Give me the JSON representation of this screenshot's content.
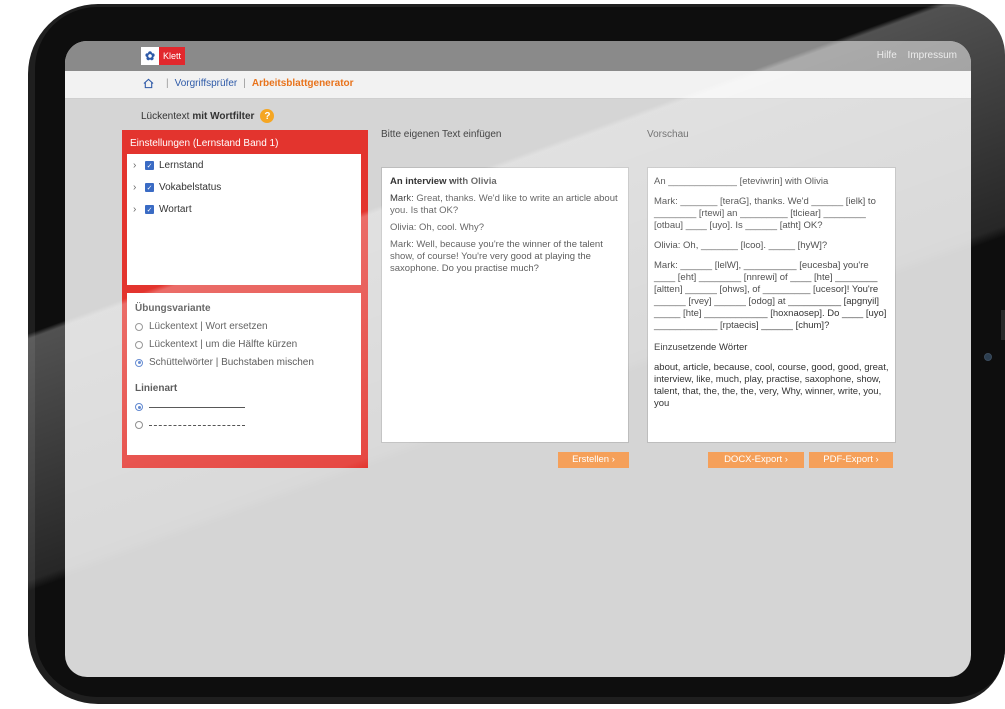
{
  "header": {
    "logo_text": "Klett",
    "links": [
      "Hilfe",
      "Impressum"
    ]
  },
  "breadcrumb": {
    "items": [
      "Vorgriffsprüfer",
      "Arbeitsblattgenerator"
    ]
  },
  "page_title": {
    "prefix": "Lückentext",
    "bold": "mit Wortfilter",
    "help": "?"
  },
  "settings": {
    "title": "Einstellungen (Lernstand Band 1)",
    "tree": [
      "Lernstand",
      "Vokabelstatus",
      "Wortart"
    ],
    "exercise_heading": "Übungsvariante",
    "exercise_options": [
      {
        "label": "Lückentext | Wort ersetzen",
        "selected": false
      },
      {
        "label": "Lückentext | um die Hälfte kürzen",
        "selected": false
      },
      {
        "label": "Schüttelwörter | Buchstaben mischen",
        "selected": true
      }
    ],
    "line_heading": "Linienart",
    "line_options": [
      {
        "style": "solid",
        "selected": true
      },
      {
        "style": "dashed",
        "selected": false
      }
    ]
  },
  "input": {
    "label": "Bitte eigenen Text einfügen",
    "title": "An interview with Olivia",
    "paragraphs": [
      "Mark: Great, thanks. We'd like to write an article about you. Is that OK?",
      "Olivia: Oh, cool. Why?",
      "Mark: Well, because you're the winner of the talent show, of course! You're very good at playing the saxophone. Do you practise much?"
    ],
    "button": "Erstellen ›"
  },
  "preview": {
    "label": "Vorschau",
    "paragraphs": [
      "An _____________ [eteviwrin] with Olivia",
      "Mark: _______ [teraG], thanks. We'd ______ [ielk] to ________ [rtewi] an _________ [tlciear] ________ [otbau] ____ [uyo]. Is ______ [atht] OK?",
      "Olivia: Oh, _______ [lcoo]. _____ [hyW]?",
      "Mark: ______ [lelW], __________ [eucesba] you're ____ [eht] ________ [nnrewi] of ____ [hte] ________ [altten] ______ [ohws], of _________ [ucesor]! You're ______ [rvey] ______ [odog] at __________ [apgnyil] _____ [hte] ____________ [hoxnaosep]. Do ____ [uyo] ____________ [rptaecis] ______ [chum]?"
    ],
    "words_heading": "Einzusetzende Wörter",
    "words": "about, article, because, cool, course, good, good, great, interview, like, much, play, practise, saxophone, show, talent, that, the, the, the, very, Why, winner, write, you, you",
    "buttons": [
      "DOCX-Export ›",
      "PDF-Export ›"
    ]
  }
}
